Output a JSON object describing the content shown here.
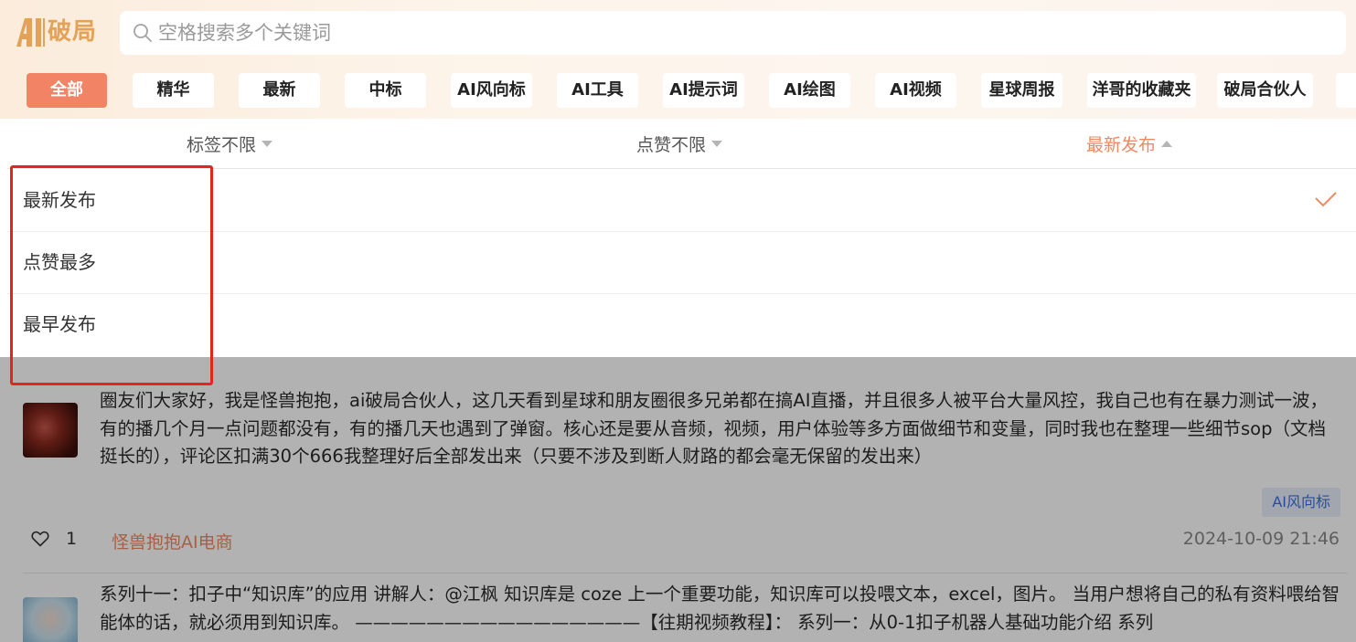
{
  "brand": {
    "name": "破局",
    "color": "#e3a256"
  },
  "search": {
    "placeholder": "空格搜索多个关键词"
  },
  "tabs": [
    {
      "label": "全部",
      "active": true
    },
    {
      "label": "精华"
    },
    {
      "label": "最新"
    },
    {
      "label": "中标"
    },
    {
      "label": "AI风向标"
    },
    {
      "label": "AI工具"
    },
    {
      "label": "AI提示词"
    },
    {
      "label": "AI绘图"
    },
    {
      "label": "AI视频"
    },
    {
      "label": "星球周报"
    },
    {
      "label": "洋哥的收藏夹"
    },
    {
      "label": "破局合伙人"
    },
    {
      "label": ""
    }
  ],
  "filters": [
    {
      "label": "标签不限",
      "caret": "down"
    },
    {
      "label": "点赞不限",
      "caret": "down"
    },
    {
      "label": "最新发布",
      "caret": "up",
      "active": true
    }
  ],
  "sort_options": [
    {
      "label": "最新发布",
      "selected": true
    },
    {
      "label": "点赞最多"
    },
    {
      "label": "最早发布"
    }
  ],
  "posts": [
    {
      "text": "圈友们大家好，我是怪兽抱抱，ai破局合伙人，这几天看到星球和朋友圈很多兄弟都在搞AI直播，并且很多人被平台大量风控，我自己也有在暴力测试一波，有的播几个月一点问题都没有，有的播几天也遇到了弹窗。核心还是要从音频，视频，用户体验等多方面做细节和变量，同时我也在整理一些细节sop（文档挺长的），评论区扣满30个666我整理好后全部发出来（只要不涉及到断人财路的都会毫无保留的发出来）",
      "tag": "AI风向标",
      "likes": "1",
      "author": "怪兽抱抱AI电商",
      "time": "2024-10-09 21:46"
    },
    {
      "text": "系列十一：扣子中“知识库”的应用 讲解人：@江枫 知识库是 coze 上一个重要功能，知识库可以投喂文本，excel，图片。 当用户想将自己的私有资料喂给智能体的话，就必须用到知识库。 ————————————————【往期视频教程】： 系列一：从0-1扣子机器人基础功能介绍 系列"
    }
  ],
  "colors": {
    "accent": "#f38365",
    "active_text": "#ee8a63",
    "highlight": "#e3261d",
    "tag_text": "#3b6fe0"
  }
}
